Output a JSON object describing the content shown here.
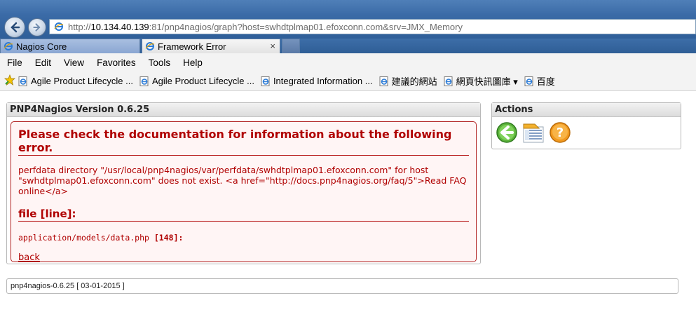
{
  "browser": {
    "address_prefix": "http://",
    "address_host": "10.134.40.139",
    "address_rest": ":81/pnp4nagios/graph?host=swhdtplmap01.efoxconn.com&srv=JMX_Memory",
    "tabs": [
      {
        "label": "Nagios Core"
      },
      {
        "label": "Framework Error",
        "close": "×"
      }
    ],
    "menu": [
      "File",
      "Edit",
      "View",
      "Favorites",
      "Tools",
      "Help"
    ],
    "favorites": [
      {
        "label": "Agile Product Lifecycle ..."
      },
      {
        "label": "Agile Product Lifecycle ..."
      },
      {
        "label": "Integrated Information ..."
      },
      {
        "label": "建議的網站"
      },
      {
        "label": "網頁快訊圖庫 ▾"
      },
      {
        "label": "百度"
      }
    ]
  },
  "main": {
    "title": "PNP4Nagios Version 0.6.25",
    "error_title": "Please check the documentation for information about the following error.",
    "error_message": "perfdata directory \"/usr/local/pnp4nagios/var/perfdata/swhdtplmap01.efoxconn.com\" for host \"swhdtplmap01.efoxconn.com\" does not exist. <a href=\"http://docs.pnp4nagios.org/faq/5\">Read FAQ online</a>",
    "file_heading": "file [line]:",
    "file_path": "application/models/data.php",
    "file_line": "[148]:",
    "back_link": "back"
  },
  "actions": {
    "title": "Actions",
    "icons": [
      "back-arrow-icon",
      "document-list-icon",
      "help-icon"
    ]
  },
  "footer": {
    "text": "pnp4nagios-0.6.25 [ 03-01-2015 ]"
  },
  "colors": {
    "error": "#b00000",
    "error_bg": "#fff5f5",
    "chrome_blue": "#3a6aa6"
  }
}
